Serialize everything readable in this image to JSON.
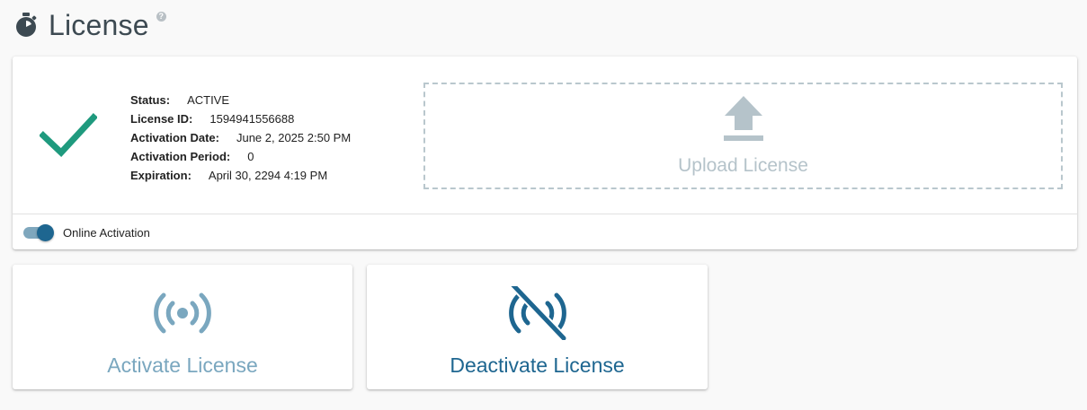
{
  "header": {
    "title": "License",
    "help_glyph": "?",
    "icon": "stopwatch-icon"
  },
  "status": {
    "icon": "checkmark-icon",
    "colors": {
      "check": "#1f9a7e"
    },
    "fields": [
      {
        "label": "Status:",
        "value": "ACTIVE"
      },
      {
        "label": "License ID:",
        "value": "1594941556688"
      },
      {
        "label": "Activation Date:",
        "value": "June 2, 2025 2:50 PM"
      },
      {
        "label": "Activation Period:",
        "value": "0"
      },
      {
        "label": "Expiration:",
        "value": "April 30, 2294 4:19 PM"
      }
    ]
  },
  "upload": {
    "label": "Upload License",
    "icon": "upload-icon"
  },
  "online_activation": {
    "label": "Online Activation",
    "enabled": true
  },
  "actions": {
    "activate": {
      "label": "Activate License",
      "icon": "broadcast-icon",
      "color": "#7aa7bf"
    },
    "deactivate": {
      "label": "Deactivate License",
      "icon": "broadcast-off-icon",
      "color": "#1e6690"
    }
  }
}
